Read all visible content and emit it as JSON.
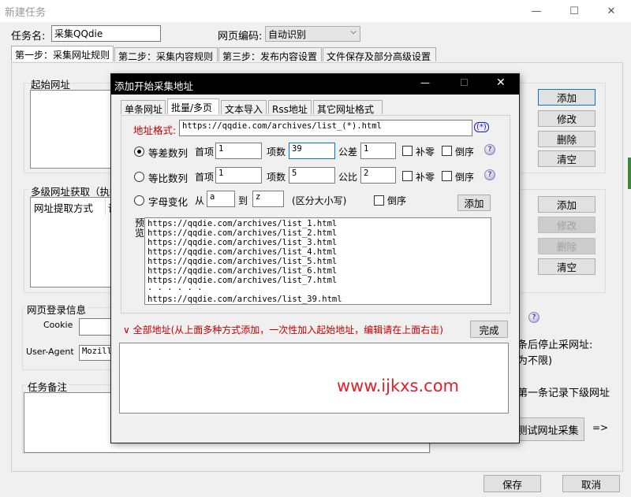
{
  "window": {
    "title": "新建任务",
    "min": "—",
    "max": "☐",
    "close": "✕"
  },
  "task": {
    "name_label": "任务名:",
    "name_value": "采集QQdie",
    "encoding_label": "网页编码:",
    "encoding_value": "自动识别"
  },
  "main_tabs": [
    "第一步：采集网址规则",
    "第二步：采集内容规则",
    "第三步：发布内容设置",
    "文件保存及部分高级设置"
  ],
  "start_url": {
    "label": "起始网址",
    "buttons": [
      "添加",
      "修改",
      "删除",
      "清空"
    ]
  },
  "multi": {
    "label": "多级网址获取（执行",
    "col1": "网址提取方式",
    "col2": "说",
    "buttons": [
      "添加",
      "修改",
      "删除",
      "清空"
    ]
  },
  "login": {
    "label": "网页登录信息",
    "cookie_label": "Cookie",
    "ua_label": "User-Agent",
    "ua_value": "Mozill"
  },
  "notes": {
    "label": "任务备注"
  },
  "right_texts": {
    "line1": "条后停止采网址:",
    "line2": "为不限)",
    "line3": "第一条记录下级网址"
  },
  "test_button": "测试网址采集",
  "arrow": "=>",
  "footer": {
    "save": "保存",
    "cancel": "取消"
  },
  "dialog": {
    "title": "添加开始采集地址",
    "min": "—",
    "max": "☐",
    "close": "✕",
    "tabs": [
      "单条网址",
      "批量/多页",
      "文本导入",
      "Rss地址",
      "其它网址格式"
    ],
    "url_format_label": "地址格式:",
    "url_format_value": "https://qqdie.com/archives/list_(*).html",
    "wildcard_icon": "(*)",
    "arith": {
      "label": "等差数列",
      "first_label": "首项",
      "first": "1",
      "count_label": "项数",
      "count": "39",
      "diff_label": "公差",
      "diff": "1",
      "pad_label": "补零",
      "rev_label": "倒序"
    },
    "geo": {
      "label": "等比数列",
      "first_label": "首项",
      "first": "1",
      "count_label": "项数",
      "count": "5",
      "ratio_label": "公比",
      "ratio": "2",
      "pad_label": "补零",
      "rev_label": "倒序"
    },
    "alpha": {
      "label": "字母变化",
      "from_label": "从",
      "from": "a",
      "to_label": "到",
      "to": "z",
      "case_label": "(区分大小写)",
      "rev_label": "倒序",
      "add": "添加"
    },
    "preview_label": "预览",
    "preview_lines": [
      "https://qqdie.com/archives/list_1.html",
      "https://qqdie.com/archives/list_2.html",
      "https://qqdie.com/archives/list_3.html",
      "https://qqdie.com/archives/list_4.html",
      "https://qqdie.com/archives/list_5.html",
      "https://qqdie.com/archives/list_6.html",
      "https://qqdie.com/archives/list_7.html",
      "· · · · · ·",
      "https://qqdie.com/archives/list_39.html"
    ],
    "all_label": "∨ 全部地址(从上面多种方式添加，一次性加入起始地址，编辑请在上面右击)",
    "done": "完成",
    "watermark": "www.ijkxs.com"
  }
}
